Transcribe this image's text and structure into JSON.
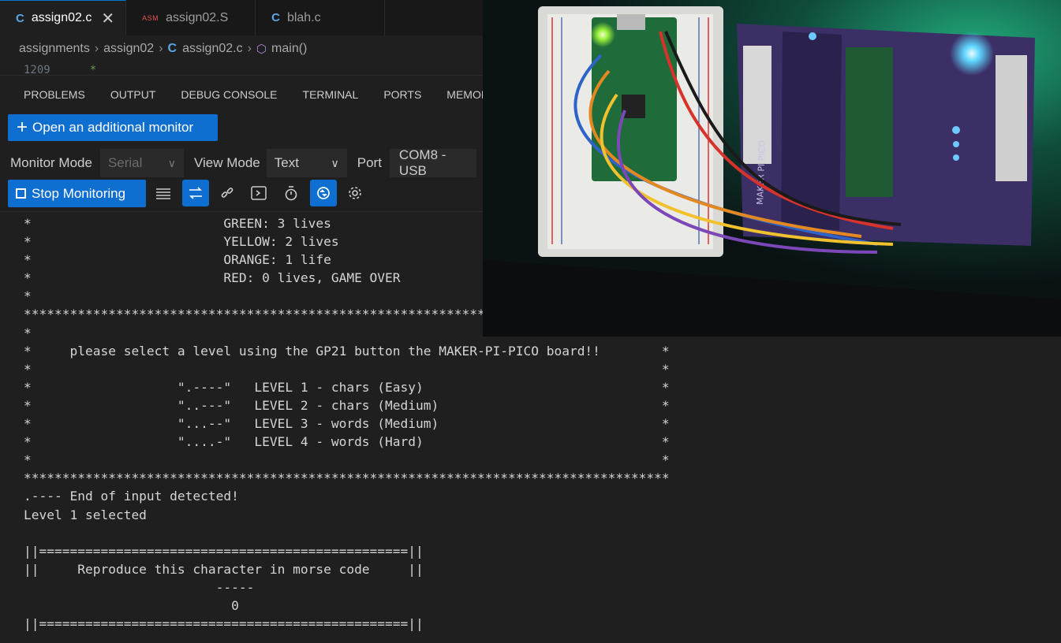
{
  "tabs": [
    {
      "icon": "C",
      "label": "assign02.c",
      "active": true,
      "close": "✕"
    },
    {
      "icon": "ASM",
      "label": "assign02.S",
      "active": false
    },
    {
      "icon": "C",
      "label": "blah.c",
      "active": false
    }
  ],
  "breadcrumb": {
    "folder1": "assignments",
    "folder2": "assign02",
    "file_icon": "C",
    "file": "assign02.c",
    "symbol": "main()"
  },
  "code_peek": {
    "line_number": "1209",
    "text": "*"
  },
  "panel_tabs": [
    "PROBLEMS",
    "OUTPUT",
    "DEBUG CONSOLE",
    "TERMINAL",
    "PORTS",
    "MEMORY"
  ],
  "monitor": {
    "add_button": "Open an additional monitor",
    "monitor_mode_label": "Monitor Mode",
    "monitor_mode_value": "Serial",
    "view_mode_label": "View Mode",
    "view_mode_value": "Text",
    "port_label": "Port",
    "port_value": "COM8 - USB",
    "stop_button": "Stop Monitoring",
    "toolbar_icons": [
      "list-icon",
      "swap-icon",
      "link-icon",
      "terminal-icon",
      "stopwatch-icon",
      "refresh-icon",
      "gear-icon"
    ]
  },
  "console_lines": [
    "*                         GREEN: 3 lives",
    "*                         YELLOW: 2 lives",
    "*                         ORANGE: 1 life",
    "*                         RED: 0 lives, GAME OVER",
    "*",
    "************************************************************************************",
    "*",
    "*     please select a level using the GP21 button the MAKER-PI-PICO board!!        *",
    "*                                                                                  *",
    "*                   \".----\"   LEVEL 1 - chars (Easy)                               *",
    "*                   \"..---\"   LEVEL 2 - chars (Medium)                             *",
    "*                   \"...--\"   LEVEL 3 - words (Medium)                             *",
    "*                   \"....-\"   LEVEL 4 - words (Hard)                               *",
    "*                                                                                  *",
    "************************************************************************************",
    ".---- End of input detected!",
    "Level 1 selected",
    "",
    "||================================================||",
    "||     Reproduce this character in morse code     ||",
    "                         -----",
    "                           0",
    "||================================================||"
  ],
  "colors": {
    "accent": "#0e6fd1",
    "background": "#1f1f1f",
    "tabbar": "#181818"
  }
}
